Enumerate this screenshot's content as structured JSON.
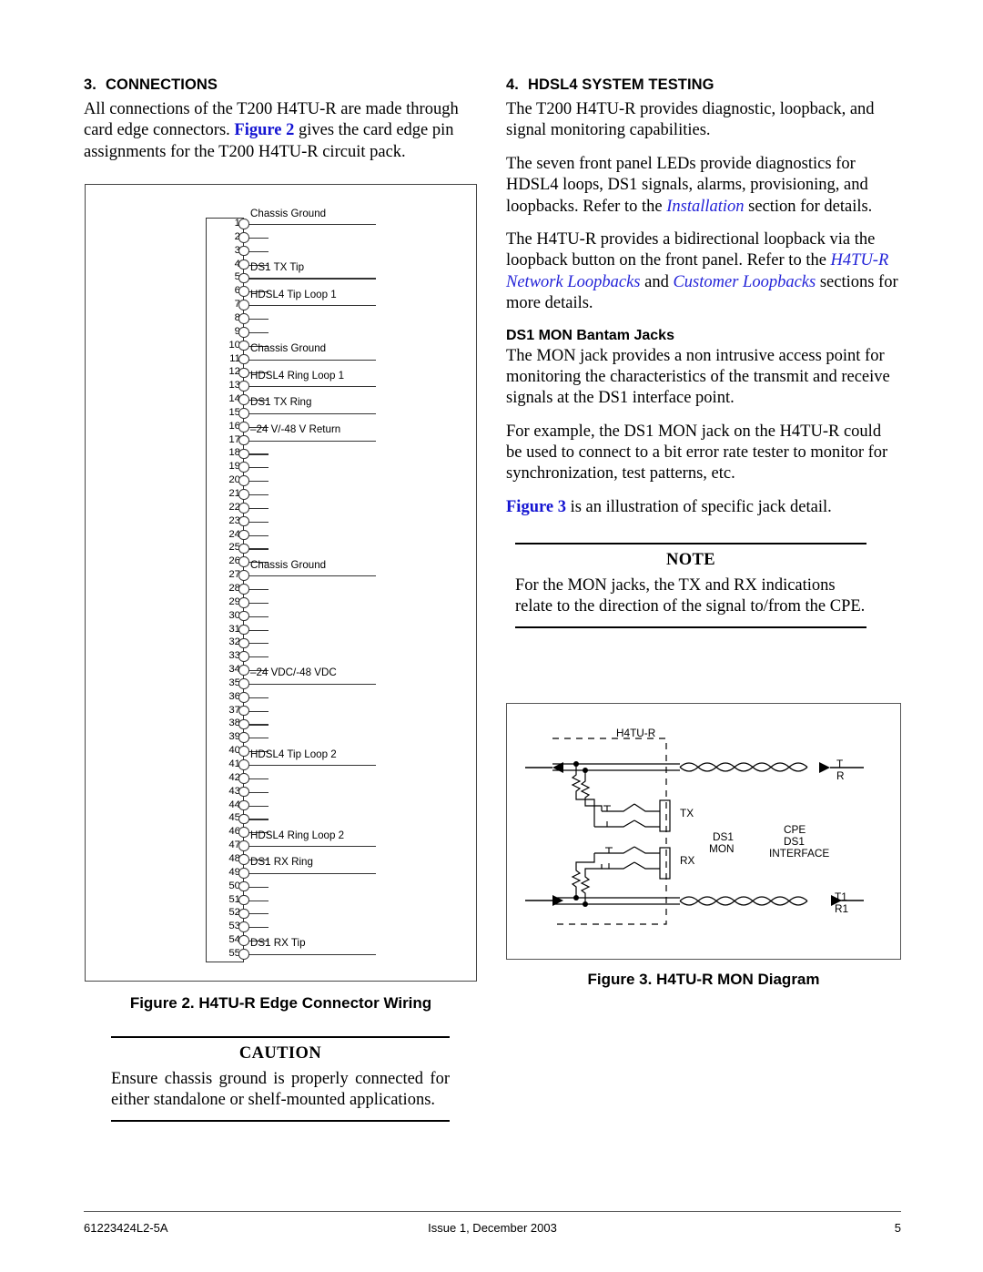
{
  "left_column": {
    "section_number": "3.",
    "section_title": "CONNECTIONS",
    "para1_a": "All connections of the T200 H4TU-R are made through card edge connectors. ",
    "para1_link": "Figure 2",
    "para1_b": " gives the card edge pin assignments for the T200 H4TU-R circuit pack."
  },
  "right_column": {
    "section_number": "4.",
    "section_title": "HDSL4 SYSTEM TESTING",
    "para1": "The T200 H4TU-R provides diagnostic, loopback, and signal monitoring capabilities.",
    "para2_a": "The seven front panel LEDs provide diagnostics for HDSL4 loops, DS1 signals, alarms, provisioning, and loopbacks. Refer to the ",
    "para2_link": "Installation",
    "para2_b": " section for details.",
    "para3_a": "The H4TU-R provides a bidirectional loopback via the loopback button on the front panel. Refer to the ",
    "para3_link1": "H4TU-R Network Loopbacks",
    "para3_mid": " and ",
    "para3_link2": "Customer Loopbacks",
    "para3_b": " sections for more details.",
    "subhead": "DS1 MON Bantam Jacks",
    "para4": "The MON jack provides a non intrusive access point for monitoring the characteristics of the transmit and receive signals at the DS1 interface point.",
    "para5": "For example, the DS1 MON jack on the H4TU-R could be used to connect to a bit error rate tester to monitor for synchronization, test patterns, etc.",
    "para6_link": "Figure 3",
    "para6_b": " is an illustration of specific jack detail."
  },
  "note_box": {
    "title": "NOTE",
    "text": "For the MON jacks, the TX and RX indications relate to the direction of the signal to/from the CPE."
  },
  "caution_box": {
    "title": "CAUTION",
    "text": "Ensure chassis ground is properly connected for either standalone or shelf-mounted applications."
  },
  "figure2": {
    "caption": "Figure 2.  H4TU-R Edge Connector Wiring",
    "pins": [
      {
        "n": "1",
        "label": "Chassis Ground"
      },
      {
        "n": "2",
        "label": ""
      },
      {
        "n": "3",
        "label": ""
      },
      {
        "n": "4",
        "label": ""
      },
      {
        "n": "5",
        "label": "DS1 TX Tip"
      },
      {
        "n": "6",
        "label": ""
      },
      {
        "n": "7",
        "label": "HDSL4 Tip Loop 1"
      },
      {
        "n": "8",
        "label": ""
      },
      {
        "n": "9",
        "label": ""
      },
      {
        "n": "10",
        "label": ""
      },
      {
        "n": "11",
        "label": "Chassis Ground"
      },
      {
        "n": "12",
        "label": ""
      },
      {
        "n": "13",
        "label": "HDSL4 Ring Loop 1"
      },
      {
        "n": "14",
        "label": ""
      },
      {
        "n": "15",
        "label": "DS1 TX Ring"
      },
      {
        "n": "16",
        "label": ""
      },
      {
        "n": "17",
        "label": "–24 V/-48 V Return"
      },
      {
        "n": "18",
        "label": ""
      },
      {
        "n": "19",
        "label": ""
      },
      {
        "n": "20",
        "label": ""
      },
      {
        "n": "21",
        "label": ""
      },
      {
        "n": "22",
        "label": ""
      },
      {
        "n": "23",
        "label": ""
      },
      {
        "n": "24",
        "label": ""
      },
      {
        "n": "25",
        "label": ""
      },
      {
        "n": "26",
        "label": ""
      },
      {
        "n": "27",
        "label": "Chassis Ground"
      },
      {
        "n": "28",
        "label": ""
      },
      {
        "n": "29",
        "label": ""
      },
      {
        "n": "30",
        "label": ""
      },
      {
        "n": "31",
        "label": ""
      },
      {
        "n": "32",
        "label": ""
      },
      {
        "n": "33",
        "label": ""
      },
      {
        "n": "34",
        "label": ""
      },
      {
        "n": "35",
        "label": "–24 VDC/-48 VDC"
      },
      {
        "n": "36",
        "label": ""
      },
      {
        "n": "37",
        "label": ""
      },
      {
        "n": "38",
        "label": ""
      },
      {
        "n": "39",
        "label": ""
      },
      {
        "n": "40",
        "label": ""
      },
      {
        "n": "41",
        "label": "HDSL4 Tip Loop 2"
      },
      {
        "n": "42",
        "label": ""
      },
      {
        "n": "43",
        "label": ""
      },
      {
        "n": "44",
        "label": ""
      },
      {
        "n": "45",
        "label": ""
      },
      {
        "n": "46",
        "label": ""
      },
      {
        "n": "47",
        "label": "HDSL4 Ring Loop 2"
      },
      {
        "n": "48",
        "label": ""
      },
      {
        "n": "49",
        "label": "DS1 RX Ring"
      },
      {
        "n": "50",
        "label": ""
      },
      {
        "n": "51",
        "label": ""
      },
      {
        "n": "52",
        "label": ""
      },
      {
        "n": "53",
        "label": ""
      },
      {
        "n": "54",
        "label": ""
      },
      {
        "n": "55",
        "label": "DS1 RX Tip"
      }
    ]
  },
  "figure3": {
    "caption": "Figure 3.  H4TU-R MON Diagram",
    "labels": {
      "device": "H4TU-R",
      "tx": "TX",
      "rx": "RX",
      "t": "T",
      "r": "R",
      "t1": "T1",
      "r1": "R1",
      "ds1": "DS1",
      "mon": "MON",
      "cpe": "CPE",
      "cpe_ds1": "DS1",
      "interface": "INTERFACE"
    }
  },
  "footer": {
    "doc_number": "61223424L2-5A",
    "issue": "Issue 1, December 2003",
    "page": "5"
  }
}
